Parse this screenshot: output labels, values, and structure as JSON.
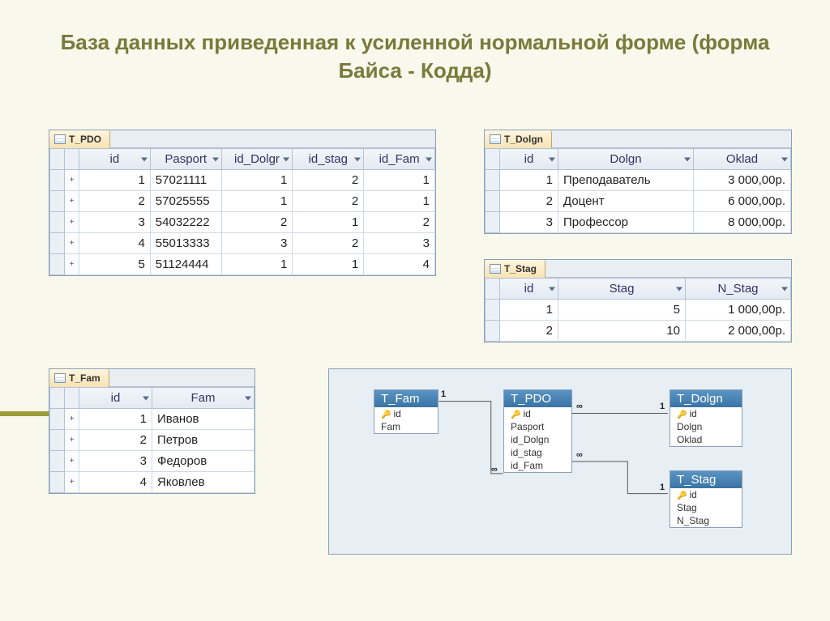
{
  "title": "База данных приведенная к усиленной нормальной форме  (форма Байса - Кодда)",
  "tables": {
    "pdo": {
      "name": "T_PDO",
      "cols": [
        "id",
        "Pasport",
        "id_Dolgr",
        "id_stag",
        "id_Fam"
      ],
      "rows": [
        [
          "1",
          "57021111",
          "1",
          "2",
          "1"
        ],
        [
          "2",
          "57025555",
          "1",
          "2",
          "1"
        ],
        [
          "3",
          "54032222",
          "2",
          "1",
          "2"
        ],
        [
          "4",
          "55013333",
          "3",
          "2",
          "3"
        ],
        [
          "5",
          "51124444",
          "1",
          "1",
          "4"
        ]
      ]
    },
    "dolgn": {
      "name": "T_Dolgn",
      "cols": [
        "id",
        "Dolgn",
        "Oklad"
      ],
      "rows": [
        [
          "1",
          "Преподаватель",
          "3 000,00р."
        ],
        [
          "2",
          "Доцент",
          "6 000,00р."
        ],
        [
          "3",
          "Профессор",
          "8 000,00р."
        ]
      ]
    },
    "stag": {
      "name": "T_Stag",
      "cols": [
        "id",
        "Stag",
        "N_Stag"
      ],
      "rows": [
        [
          "1",
          "5",
          "1 000,00р."
        ],
        [
          "2",
          "10",
          "2 000,00р."
        ]
      ]
    },
    "fam": {
      "name": "T_Fam",
      "cols": [
        "id",
        "Fam"
      ],
      "rows": [
        [
          "1",
          "Иванов"
        ],
        [
          "2",
          "Петров"
        ],
        [
          "3",
          "Федоров"
        ],
        [
          "4",
          "Яковлев"
        ]
      ]
    }
  },
  "diagram": {
    "entities": {
      "fam": {
        "title": "T_Fam",
        "fields": [
          {
            "n": "id",
            "pk": true
          },
          {
            "n": "Fam"
          }
        ]
      },
      "pdo": {
        "title": "T_PDO",
        "fields": [
          {
            "n": "id",
            "pk": true
          },
          {
            "n": "Pasport"
          },
          {
            "n": "id_Dolgn"
          },
          {
            "n": "id_stag"
          },
          {
            "n": "id_Fam"
          }
        ]
      },
      "dolgn": {
        "title": "T_Dolgn",
        "fields": [
          {
            "n": "id",
            "pk": true
          },
          {
            "n": "Dolgn"
          },
          {
            "n": "Oklad"
          }
        ]
      },
      "stag": {
        "title": "T_Stag",
        "fields": [
          {
            "n": "id",
            "pk": true
          },
          {
            "n": "Stag"
          },
          {
            "n": "N_Stag"
          }
        ]
      }
    },
    "labels": {
      "one": "1",
      "inf": "∞"
    }
  }
}
